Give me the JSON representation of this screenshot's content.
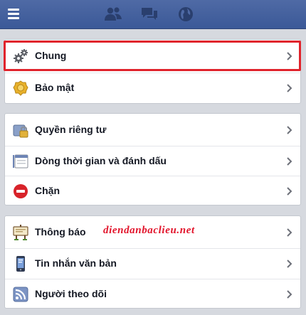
{
  "topbar": {
    "menu_icon": "hamburger-menu-icon",
    "jewels": [
      "friend-requests-icon",
      "messages-icon",
      "notifications-globe-icon"
    ]
  },
  "sections": [
    {
      "items": [
        {
          "label": "Chung",
          "icon": "gears-icon",
          "selected": true
        },
        {
          "label": "Bảo mật",
          "icon": "security-badge-icon"
        }
      ]
    },
    {
      "items": [
        {
          "label": "Quyền riêng tư",
          "icon": "privacy-lock-icon"
        },
        {
          "label": "Dòng thời gian và đánh dấu",
          "icon": "timeline-icon"
        },
        {
          "label": "Chặn",
          "icon": "block-icon"
        }
      ]
    },
    {
      "items": [
        {
          "label": "Thông báo",
          "icon": "notification-sign-icon"
        },
        {
          "label": "Tin nhắn văn bản",
          "icon": "phone-icon"
        },
        {
          "label": "Người theo dõi",
          "icon": "rss-icon"
        }
      ]
    }
  ],
  "watermark": "diendanbaclieu.net",
  "colors": {
    "topbar": "#3b5998",
    "highlight": "#e0242c",
    "watermark": "#e2142b"
  }
}
